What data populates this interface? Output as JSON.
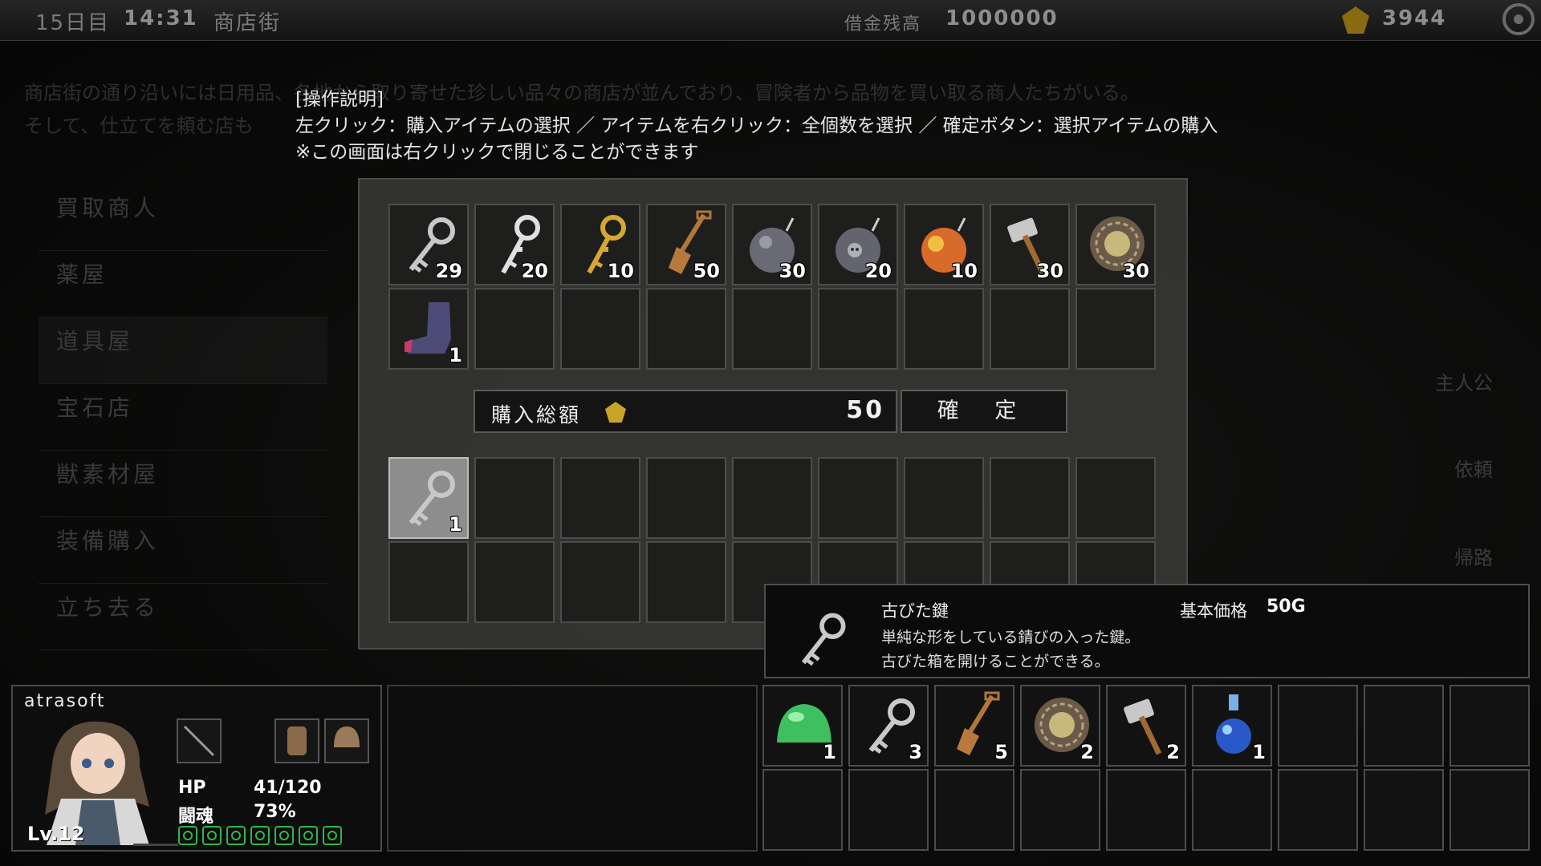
{
  "topbar": {
    "day": "15日目",
    "time": "14:31",
    "location": "商店街",
    "debt_label": "借金残高",
    "debt_value": "1000000",
    "gold": "3944"
  },
  "background_text": {
    "line1": "商店街の通り沿いには日用品、各地から取り寄せた珍しい品々の商店が並んでおり、冒険者から品物を買い取る商人たちがいる。",
    "line2": "そして、仕立てを頼む店も",
    "menu": [
      "買取商人",
      "薬屋",
      "道具屋",
      "宝石店",
      "獣素材屋",
      "装備購入",
      "立ち去る"
    ],
    "right": [
      "主人公",
      "依頼",
      "帰路"
    ]
  },
  "instructions": {
    "title": "[操作説明]",
    "line1": "左クリック：購入アイテムの選択 ／ アイテムを右クリック：全個数を選択 ／ 確定ボタン：選択アイテムの購入",
    "line2": "※この画面は右クリックで閉じることができます"
  },
  "shop_items": [
    {
      "icon": "old-key-icon",
      "qty": "29"
    },
    {
      "icon": "silver-key-icon",
      "qty": "20"
    },
    {
      "icon": "gold-key-icon",
      "qty": "10"
    },
    {
      "icon": "shovel-icon",
      "qty": "50"
    },
    {
      "icon": "bomb-icon",
      "qty": "30"
    },
    {
      "icon": "skull-bomb-icon",
      "qty": "20"
    },
    {
      "icon": "fire-bomb-icon",
      "qty": "10"
    },
    {
      "icon": "hammer-icon",
      "qty": "30"
    },
    {
      "icon": "net-icon",
      "qty": "30"
    },
    {
      "icon": "boots-icon",
      "qty": "1"
    }
  ],
  "purchase": {
    "total_label": "購入総額",
    "total_value": "50",
    "confirm_label": "確 定"
  },
  "cart_items": [
    {
      "icon": "old-key-icon",
      "qty": "1"
    }
  ],
  "tooltip": {
    "name": "古びた鍵",
    "desc1": "単純な形をしている錆びの入った鍵。",
    "desc2": "古びた箱を開けることができる。",
    "price_label": "基本価格",
    "price_value": "50G"
  },
  "player": {
    "name": "atrasoft",
    "level": "Lv.12",
    "hp_label": "HP",
    "hp_value": "41/120",
    "hp_fraction": 0.34,
    "spirit_label": "闘魂",
    "spirit_value": "73%",
    "spirit_fraction": 0.73,
    "pip_count": 7
  },
  "inventory": [
    {
      "icon": "green-slime-icon",
      "qty": "1"
    },
    {
      "icon": "old-key-icon",
      "qty": "3"
    },
    {
      "icon": "shovel-icon",
      "qty": "5"
    },
    {
      "icon": "net-icon",
      "qty": "2"
    },
    {
      "icon": "hammer-icon",
      "qty": "2"
    },
    {
      "icon": "potion-icon",
      "qty": "1"
    }
  ],
  "colors": {
    "hp": "#2fb64a",
    "spirit": "#6b4bd6",
    "selected_slot": "#8d8d8d"
  }
}
